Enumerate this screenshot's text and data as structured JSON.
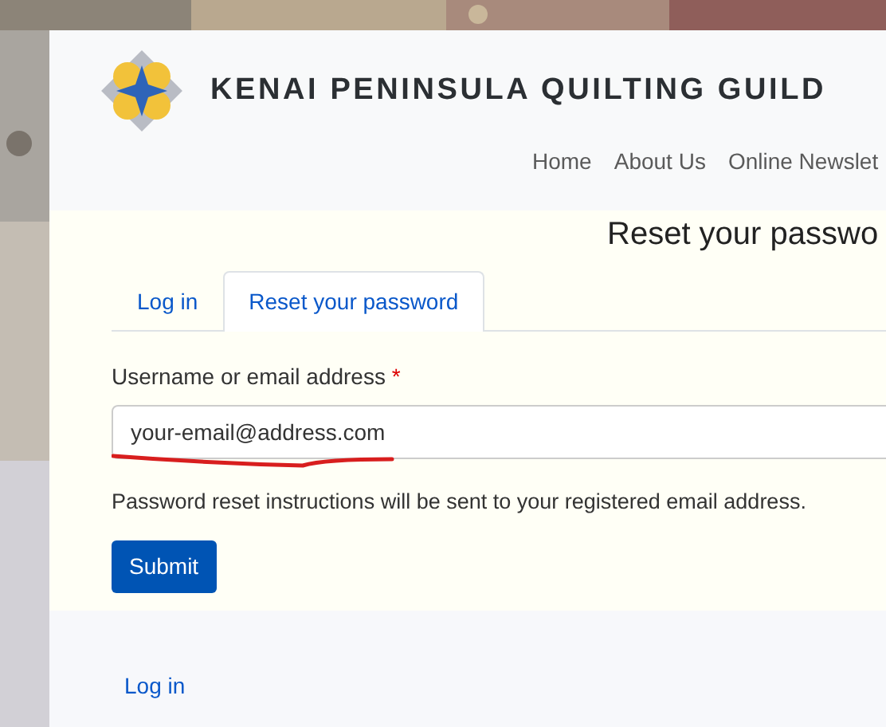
{
  "site": {
    "title": "KENAI PENINSULA QUILTING GUILD"
  },
  "nav": [
    "Home",
    "About Us",
    "Online Newslet"
  ],
  "heading": "Reset your passwo",
  "tabs": [
    {
      "label": "Log in",
      "selected": false
    },
    {
      "label": "Reset your password",
      "selected": true
    }
  ],
  "form": {
    "label": "Username or email address",
    "required_mark": "*",
    "value": "your-email@address.com",
    "help": "Password reset instructions will be sent to your registered email address.",
    "submit": "Submit"
  },
  "footer": {
    "link": "Log in"
  }
}
